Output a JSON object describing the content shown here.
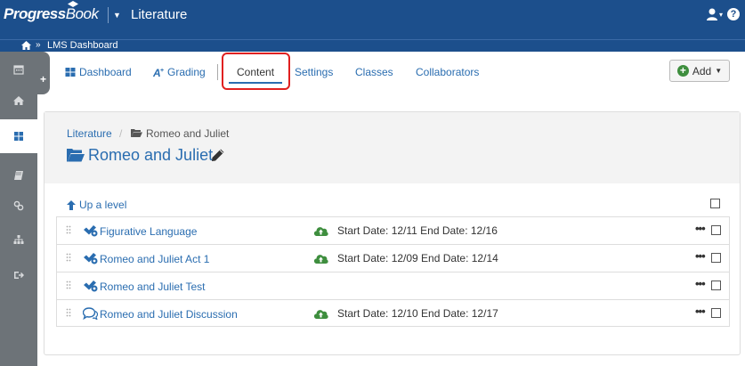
{
  "header": {
    "logo_text_a": "Progress",
    "logo_text_b": "Book",
    "course_title": "Literature",
    "user_caret": "▾",
    "help": "?"
  },
  "breadcrumb_bar": {
    "separator": "»",
    "lms": "LMS Dashboard"
  },
  "rail": {
    "tab_label": "+",
    "items": [
      {
        "icon": "calendar-icon"
      },
      {
        "icon": "home-icon"
      },
      {
        "icon": "dashboard-grid-icon",
        "active": true
      },
      {
        "icon": "book-icon"
      },
      {
        "icon": "link-icon"
      },
      {
        "icon": "sitemap-icon"
      },
      {
        "icon": "sign-out-icon"
      }
    ]
  },
  "nav": {
    "dashboard": "Dashboard",
    "grading": "Grading",
    "content": "Content",
    "settings": "Settings",
    "classes": "Classes",
    "collaborators": "Collaborators",
    "add": "Add"
  },
  "panel": {
    "crumb_root": "Literature",
    "crumb_sep": "/",
    "crumb_current": "Romeo and Juliet",
    "title": "Romeo and Juliet",
    "up_level": "Up a level"
  },
  "items": [
    {
      "name": "Figurative Language",
      "type": "assessment",
      "dates": "Start Date: 12/11 End Date: 12/16",
      "published": true
    },
    {
      "name": "Romeo and Juliet Act 1",
      "type": "assessment",
      "dates": "Start Date: 12/09 End Date: 12/14",
      "published": true
    },
    {
      "name": "Romeo and Juliet Test",
      "type": "assessment",
      "dates": "",
      "published": false
    },
    {
      "name": "Romeo and Juliet Discussion",
      "type": "discussion",
      "dates": "Start Date: 12/10 End Date: 12/17",
      "published": true
    }
  ],
  "colors": {
    "header_blue": "#1c4f8c",
    "link_blue": "#2a6db0",
    "rail_gray": "#6d7378",
    "highlight_red": "#e02020",
    "publish_green": "#3e8e3e"
  }
}
